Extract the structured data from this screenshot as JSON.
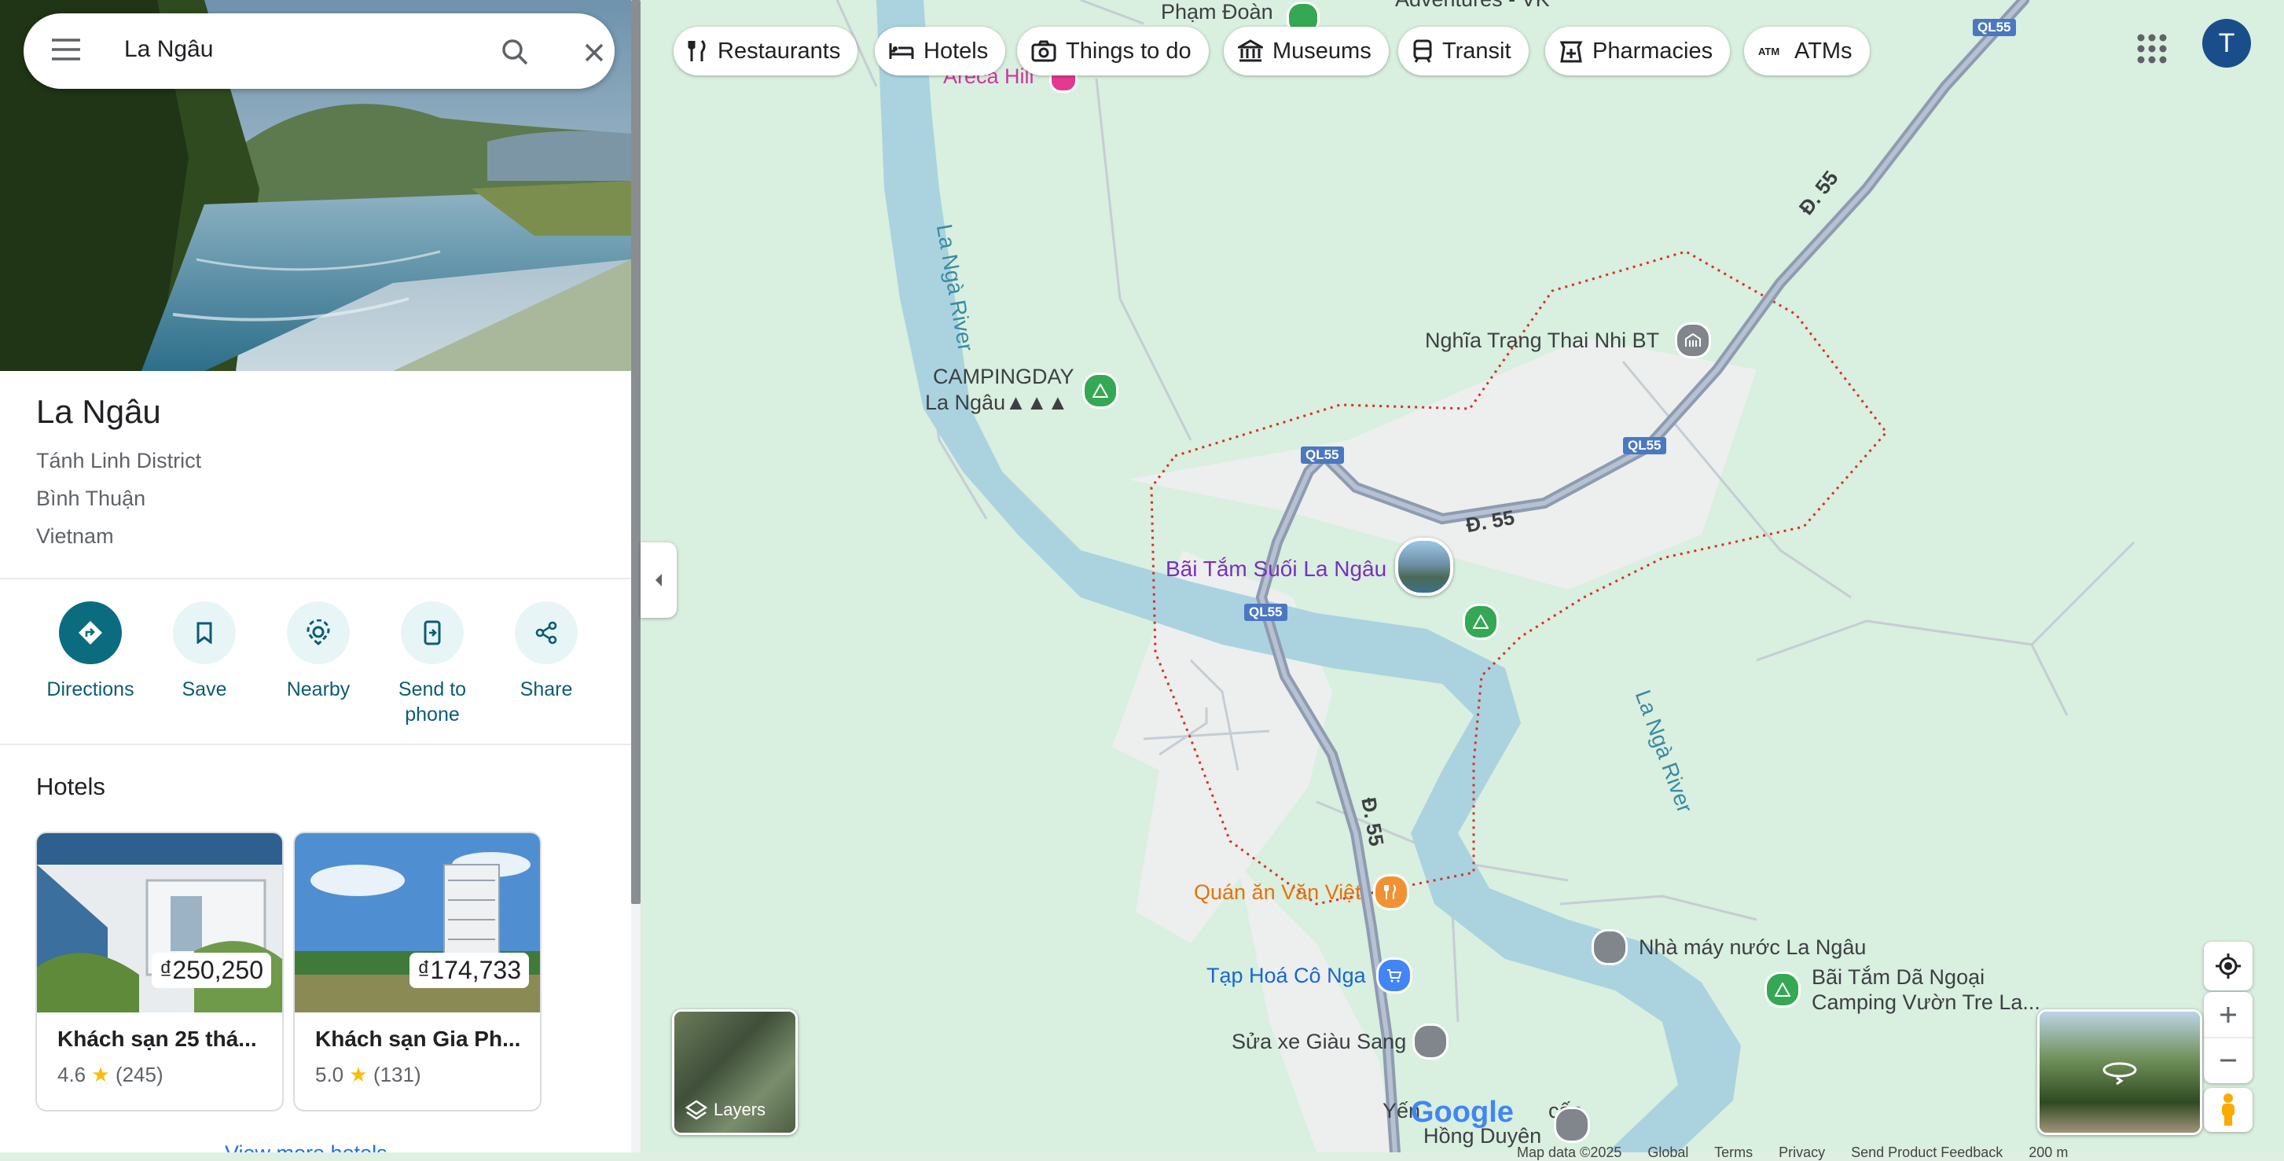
{
  "search": {
    "query": "La Ngâu"
  },
  "place": {
    "title": "La Ngâu",
    "lines": [
      "Tánh Linh District",
      "Bình Thuận",
      "Vietnam"
    ]
  },
  "actions": [
    {
      "label": "Directions",
      "icon": "directions-icon"
    },
    {
      "label": "Save",
      "icon": "bookmark-icon"
    },
    {
      "label": "Nearby",
      "icon": "nearby-icon"
    },
    {
      "label": "Send to phone",
      "icon": "send-to-phone-icon"
    },
    {
      "label": "Share",
      "icon": "share-icon"
    }
  ],
  "hotels": {
    "heading": "Hotels",
    "items": [
      {
        "name": "Khách sạn 25 thá...",
        "price": "₫250,250",
        "rating": "4.6",
        "reviews": "(245)"
      },
      {
        "name": "Khách sạn Gia Ph...",
        "price": "₫174,733",
        "rating": "5.0",
        "reviews": "(131)"
      }
    ],
    "more": "View more hotels"
  },
  "chips": [
    "Restaurants",
    "Hotels",
    "Things to do",
    "Museums",
    "Transit",
    "Pharmacies",
    "ATMs"
  ],
  "account": {
    "initial": "T"
  },
  "layers_label": "Layers",
  "map_labels": {
    "pham_doan": "Phạm Đoàn",
    "adventures": "Adventures - VK",
    "areca": "Areca Hill",
    "la_nga_river": "La Ngà River",
    "camping_1": "CAMPINGDAY",
    "camping_2": "La Ngâu▲▲▲",
    "nghia_trang": "Nghĩa Trang Thai Nhi BT",
    "bai_tam": "Bãi Tắm Suối La Ngâu",
    "quan_an": "Quán ăn Văn Việt",
    "tap_hoa": "Tạp Hoá Cô Nga",
    "sua_xe": "Sửa xe Giàu Sang",
    "nha_may": "Nhà máy nước La Ngâu",
    "bai_tam_dn_1": "Bãi Tắm Dã Ngoại",
    "bai_tam_dn_2": "Camping Vườn Tre La...",
    "yen": "Yến",
    "cap": "cấp",
    "hong_duyen": "Hồng Duyên",
    "road_d55": "Đ. 55",
    "shield_ql55": "QL55",
    "google": "Google"
  },
  "footer": [
    "Map data ©2025",
    "Global",
    "Terms",
    "Privacy",
    "Send Product Feedback",
    "200 m"
  ],
  "colors": {
    "accent": "#0b6c80",
    "river": "#aad3df",
    "road": "#8e9bb0",
    "boundary": "#d93025"
  }
}
